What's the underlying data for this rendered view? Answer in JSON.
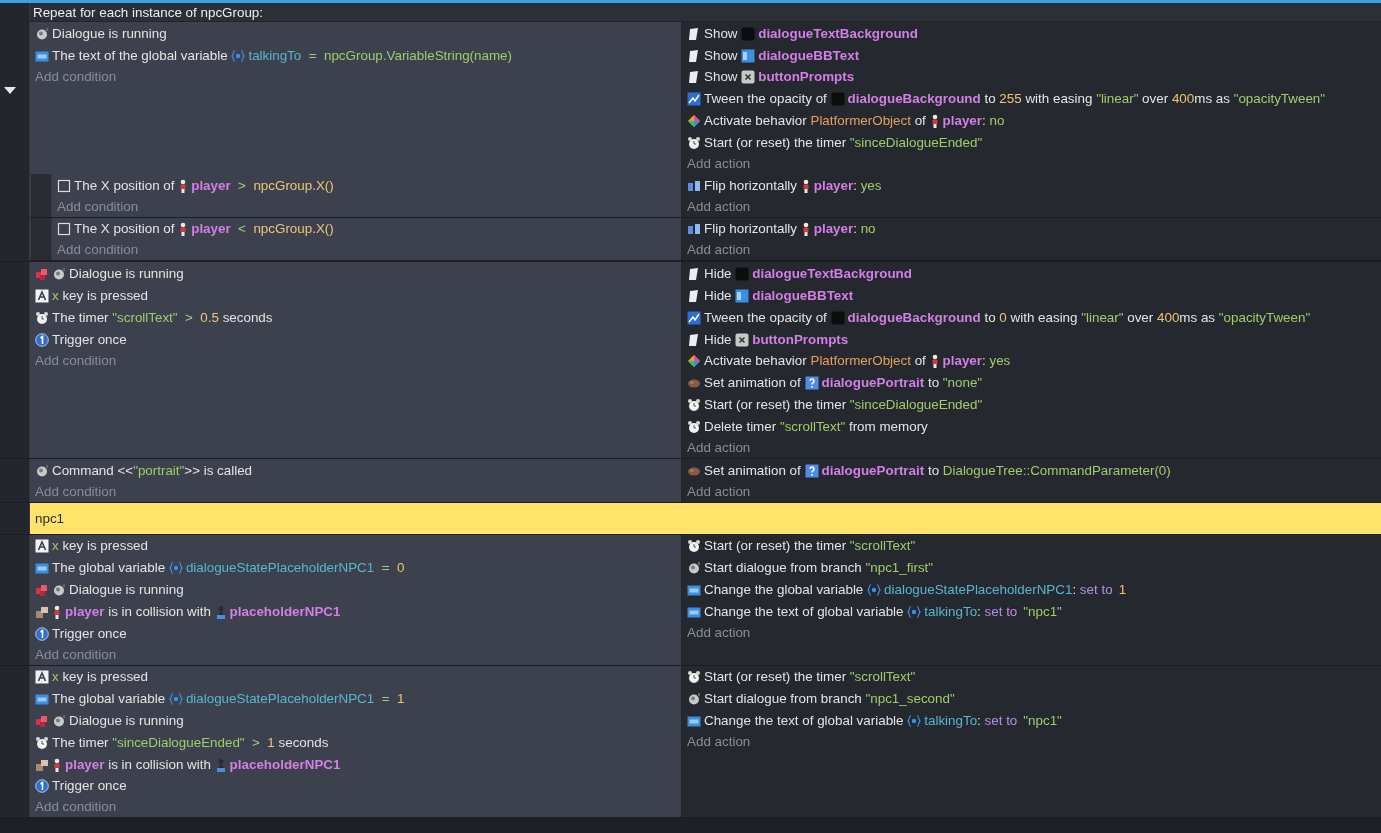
{
  "events": [
    {
      "kind": "foreach",
      "header": "Repeat for each instance of npcGroup:",
      "add_condition": "Add condition",
      "add_action": "Add action",
      "conditions": [
        {
          "kind": "dialogue",
          "inverted": false,
          "parts": [
            {
              "kind": "plain",
              "text": "Dialogue is running"
            }
          ]
        },
        {
          "kind": "variable",
          "inverted": false,
          "parts": [
            {
              "kind": "plain",
              "text": "The text of the global variable "
            },
            {
              "kind": "var",
              "text": "talkingTo"
            },
            {
              "kind": "op",
              "text": "  =  "
            },
            {
              "kind": "str",
              "text": "npcGroup.VariableString(name)"
            }
          ]
        }
      ],
      "actions": [
        {
          "kind": "visibility",
          "parts": [
            {
              "kind": "plain",
              "text": "Show "
            },
            {
              "kind": "blackbox",
              "text": "dialogueTextBackground"
            }
          ]
        },
        {
          "kind": "visibility",
          "parts": [
            {
              "kind": "plain",
              "text": "Show "
            },
            {
              "kind": "bbtext",
              "text": "dialogueBBText"
            }
          ]
        },
        {
          "kind": "visibility",
          "parts": [
            {
              "kind": "plain",
              "text": "Show "
            },
            {
              "kind": "xkey",
              "text": "buttonPrompts"
            }
          ]
        },
        {
          "kind": "tween",
          "parts": [
            {
              "kind": "plain",
              "text": "Tween the opacity of "
            },
            {
              "kind": "blackbox",
              "text": "dialogueBackground"
            },
            {
              "kind": "plain",
              "text": " to "
            },
            {
              "kind": "num",
              "text": "255"
            },
            {
              "kind": "plain",
              "text": " with easing "
            },
            {
              "kind": "str",
              "text": "\"linear\""
            },
            {
              "kind": "plain",
              "text": " over "
            },
            {
              "kind": "num",
              "text": "400"
            },
            {
              "kind": "plain",
              "text": "ms as "
            },
            {
              "kind": "str",
              "text": "\"opacityTween\""
            }
          ]
        },
        {
          "kind": "behavior",
          "parts": [
            {
              "kind": "plain",
              "text": "Activate behavior "
            },
            {
              "kind": "beh",
              "text": "PlatformerObject"
            },
            {
              "kind": "plain",
              "text": " of "
            },
            {
              "kind": "figure",
              "text": "player"
            },
            {
              "kind": "plain",
              "text": ": "
            },
            {
              "kind": "str",
              "text": "no"
            }
          ]
        },
        {
          "kind": "timer",
          "parts": [
            {
              "kind": "plain",
              "text": "Start (or reset) the timer "
            },
            {
              "kind": "str",
              "text": "\"sinceDialogueEnded\""
            }
          ]
        }
      ],
      "children": [
        {
          "kind": "standard",
          "add_condition": "Add condition",
          "add_action": "Add action",
          "conditions": [
            {
              "kind": "square",
              "inverted": false,
              "parts": [
                {
                  "kind": "plain",
                  "text": "The X position of "
                },
                {
                  "kind": "figure",
                  "text": "player"
                },
                {
                  "kind": "op",
                  "text": "  >  "
                },
                {
                  "kind": "num",
                  "text": "npcGroup.X()"
                }
              ]
            }
          ],
          "actions": [
            {
              "kind": "flip",
              "parts": [
                {
                  "kind": "plain",
                  "text": "Flip horizontally "
                },
                {
                  "kind": "figure",
                  "text": "player"
                },
                {
                  "kind": "plain",
                  "text": ": "
                },
                {
                  "kind": "str",
                  "text": "yes"
                }
              ]
            }
          ]
        },
        {
          "kind": "standard",
          "add_condition": "Add condition",
          "add_action": "Add action",
          "conditions": [
            {
              "kind": "square",
              "inverted": false,
              "parts": [
                {
                  "kind": "plain",
                  "text": "The X position of "
                },
                {
                  "kind": "figure",
                  "text": "player"
                },
                {
                  "kind": "op",
                  "text": "  <  "
                },
                {
                  "kind": "num",
                  "text": "npcGroup.X()"
                }
              ]
            }
          ],
          "actions": [
            {
              "kind": "flip",
              "parts": [
                {
                  "kind": "plain",
                  "text": "Flip horizontally "
                },
                {
                  "kind": "figure",
                  "text": "player"
                },
                {
                  "kind": "plain",
                  "text": ": "
                },
                {
                  "kind": "str",
                  "text": "no"
                }
              ]
            }
          ]
        }
      ]
    },
    {
      "kind": "standard",
      "add_condition": "Add condition",
      "add_action": "Add action",
      "conditions": [
        {
          "kind": "dialogue",
          "inverted": true,
          "parts": [
            {
              "kind": "plain",
              "text": "Dialogue is running"
            }
          ]
        },
        {
          "kind": "key",
          "inverted": false,
          "parts": [
            {
              "kind": "str",
              "text": "x"
            },
            {
              "kind": "plain",
              "text": " key is pressed"
            }
          ]
        },
        {
          "kind": "timer",
          "inverted": false,
          "parts": [
            {
              "kind": "plain",
              "text": "The timer "
            },
            {
              "kind": "str",
              "text": "\"scrollText\""
            },
            {
              "kind": "op",
              "text": "  >  "
            },
            {
              "kind": "num",
              "text": "0.5"
            },
            {
              "kind": "plain",
              "text": " seconds"
            }
          ]
        },
        {
          "kind": "trigger",
          "inverted": false,
          "parts": [
            {
              "kind": "plain",
              "text": "Trigger once"
            }
          ]
        }
      ],
      "actions": [
        {
          "kind": "visibility",
          "parts": [
            {
              "kind": "plain",
              "text": "Hide "
            },
            {
              "kind": "blackbox",
              "text": "dialogueTextBackground"
            }
          ]
        },
        {
          "kind": "visibility",
          "parts": [
            {
              "kind": "plain",
              "text": "Hide "
            },
            {
              "kind": "bbtext",
              "text": "dialogueBBText"
            }
          ]
        },
        {
          "kind": "tween",
          "parts": [
            {
              "kind": "plain",
              "text": "Tween the opacity of "
            },
            {
              "kind": "blackbox",
              "text": "dialogueBackground"
            },
            {
              "kind": "plain",
              "text": " to "
            },
            {
              "kind": "num",
              "text": "0"
            },
            {
              "kind": "plain",
              "text": " with easing "
            },
            {
              "kind": "str",
              "text": "\"linear\""
            },
            {
              "kind": "plain",
              "text": " over "
            },
            {
              "kind": "num",
              "text": "400"
            },
            {
              "kind": "plain",
              "text": "ms as "
            },
            {
              "kind": "str",
              "text": "\"opacityTween\""
            }
          ]
        },
        {
          "kind": "visibility",
          "parts": [
            {
              "kind": "plain",
              "text": "Hide "
            },
            {
              "kind": "xkey",
              "text": "buttonPrompts"
            }
          ]
        },
        {
          "kind": "behavior",
          "parts": [
            {
              "kind": "plain",
              "text": "Activate behavior "
            },
            {
              "kind": "beh",
              "text": "PlatformerObject"
            },
            {
              "kind": "plain",
              "text": " of "
            },
            {
              "kind": "figure",
              "text": "player"
            },
            {
              "kind": "plain",
              "text": ": "
            },
            {
              "kind": "str",
              "text": "yes"
            }
          ]
        },
        {
          "kind": "animation",
          "parts": [
            {
              "kind": "plain",
              "text": "Set animation of "
            },
            {
              "kind": "qmark",
              "text": "dialoguePortrait"
            },
            {
              "kind": "plain",
              "text": " to "
            },
            {
              "kind": "str",
              "text": "\"none\""
            }
          ]
        },
        {
          "kind": "timer",
          "parts": [
            {
              "kind": "plain",
              "text": "Start (or reset) the timer "
            },
            {
              "kind": "str",
              "text": "\"sinceDialogueEnded\""
            }
          ]
        },
        {
          "kind": "timer",
          "parts": [
            {
              "kind": "plain",
              "text": "Delete timer "
            },
            {
              "kind": "str",
              "text": "\"scrollText\""
            },
            {
              "kind": "plain",
              "text": " from memory"
            }
          ]
        }
      ]
    },
    {
      "kind": "standard",
      "add_condition": "Add condition",
      "add_action": "Add action",
      "conditions": [
        {
          "kind": "dialogue",
          "inverted": false,
          "parts": [
            {
              "kind": "plain",
              "text": "Command <<"
            },
            {
              "kind": "str",
              "text": "\"portrait\""
            },
            {
              "kind": "plain",
              "text": ">> is called"
            }
          ]
        }
      ],
      "actions": [
        {
          "kind": "animation",
          "parts": [
            {
              "kind": "plain",
              "text": "Set animation of "
            },
            {
              "kind": "qmark",
              "text": "dialoguePortrait"
            },
            {
              "kind": "plain",
              "text": " to "
            },
            {
              "kind": "str",
              "text": "DialogueTree::CommandParameter(0)"
            }
          ]
        }
      ]
    },
    {
      "kind": "comment",
      "text": "npc1"
    },
    {
      "kind": "standard",
      "add_condition": "Add condition",
      "add_action": "Add action",
      "conditions": [
        {
          "kind": "key",
          "inverted": false,
          "parts": [
            {
              "kind": "str",
              "text": "x"
            },
            {
              "kind": "plain",
              "text": " key is pressed"
            }
          ]
        },
        {
          "kind": "variable",
          "inverted": false,
          "parts": [
            {
              "kind": "plain",
              "text": "The global variable "
            },
            {
              "kind": "var",
              "text": "dialogueStatePlaceholderNPC1"
            },
            {
              "kind": "op",
              "text": "  =  "
            },
            {
              "kind": "num",
              "text": "0"
            }
          ]
        },
        {
          "kind": "dialogue",
          "inverted": true,
          "parts": [
            {
              "kind": "plain",
              "text": "Dialogue is running"
            }
          ]
        },
        {
          "kind": "collision",
          "inverted": false,
          "parts": [
            {
              "kind": "figure",
              "text": "player"
            },
            {
              "kind": "plain",
              "text": " is in collision with "
            },
            {
              "kind": "npc",
              "text": "placeholderNPC1"
            }
          ]
        },
        {
          "kind": "trigger",
          "inverted": false,
          "parts": [
            {
              "kind": "plain",
              "text": "Trigger once"
            }
          ]
        }
      ],
      "actions": [
        {
          "kind": "timer",
          "parts": [
            {
              "kind": "plain",
              "text": "Start (or reset) the timer "
            },
            {
              "kind": "str",
              "text": "\"scrollText\""
            }
          ]
        },
        {
          "kind": "dialogue",
          "parts": [
            {
              "kind": "plain",
              "text": "Start dialogue from branch "
            },
            {
              "kind": "str",
              "text": "\"npc1_first\""
            }
          ]
        },
        {
          "kind": "variable",
          "parts": [
            {
              "kind": "plain",
              "text": "Change the global variable "
            },
            {
              "kind": "var",
              "text": "dialogueStatePlaceholderNPC1"
            },
            {
              "kind": "plain",
              "text": ": "
            },
            {
              "kind": "kw",
              "text": "set to"
            },
            {
              "kind": "num",
              "text": "1"
            }
          ]
        },
        {
          "kind": "variable",
          "parts": [
            {
              "kind": "plain",
              "text": "Change the text of global variable "
            },
            {
              "kind": "var",
              "text": "talkingTo"
            },
            {
              "kind": "plain",
              "text": ": "
            },
            {
              "kind": "kw",
              "text": "set to"
            },
            {
              "kind": "str",
              "text": "\"npc1\""
            }
          ]
        }
      ]
    },
    {
      "kind": "standard",
      "add_condition": "Add condition",
      "add_action": "Add action",
      "conditions": [
        {
          "kind": "key",
          "inverted": false,
          "parts": [
            {
              "kind": "str",
              "text": "x"
            },
            {
              "kind": "plain",
              "text": " key is pressed"
            }
          ]
        },
        {
          "kind": "variable",
          "inverted": false,
          "parts": [
            {
              "kind": "plain",
              "text": "The global variable "
            },
            {
              "kind": "var",
              "text": "dialogueStatePlaceholderNPC1"
            },
            {
              "kind": "op",
              "text": "  =  "
            },
            {
              "kind": "num",
              "text": "1"
            }
          ]
        },
        {
          "kind": "dialogue",
          "inverted": true,
          "parts": [
            {
              "kind": "plain",
              "text": "Dialogue is running"
            }
          ]
        },
        {
          "kind": "timer",
          "inverted": false,
          "parts": [
            {
              "kind": "plain",
              "text": "The timer "
            },
            {
              "kind": "str",
              "text": "\"sinceDialogueEnded\""
            },
            {
              "kind": "op",
              "text": "  >  "
            },
            {
              "kind": "num",
              "text": "1"
            },
            {
              "kind": "plain",
              "text": " seconds"
            }
          ]
        },
        {
          "kind": "collision",
          "inverted": false,
          "parts": [
            {
              "kind": "figure",
              "text": "player"
            },
            {
              "kind": "plain",
              "text": " is in collision with "
            },
            {
              "kind": "npc",
              "text": "placeholderNPC1"
            }
          ]
        },
        {
          "kind": "trigger",
          "inverted": false,
          "parts": [
            {
              "kind": "plain",
              "text": "Trigger once"
            }
          ]
        }
      ],
      "actions": [
        {
          "kind": "timer",
          "parts": [
            {
              "kind": "plain",
              "text": "Start (or reset) the timer "
            },
            {
              "kind": "str",
              "text": "\"scrollText\""
            }
          ]
        },
        {
          "kind": "dialogue",
          "parts": [
            {
              "kind": "plain",
              "text": "Start dialogue from branch "
            },
            {
              "kind": "str",
              "text": "\"npc1_second\""
            }
          ]
        },
        {
          "kind": "variable",
          "parts": [
            {
              "kind": "plain",
              "text": "Change the text of global variable "
            },
            {
              "kind": "var",
              "text": "talkingTo"
            },
            {
              "kind": "plain",
              "text": ": "
            },
            {
              "kind": "kw",
              "text": "set to"
            },
            {
              "kind": "str",
              "text": "\"npc1\""
            }
          ]
        }
      ]
    }
  ]
}
